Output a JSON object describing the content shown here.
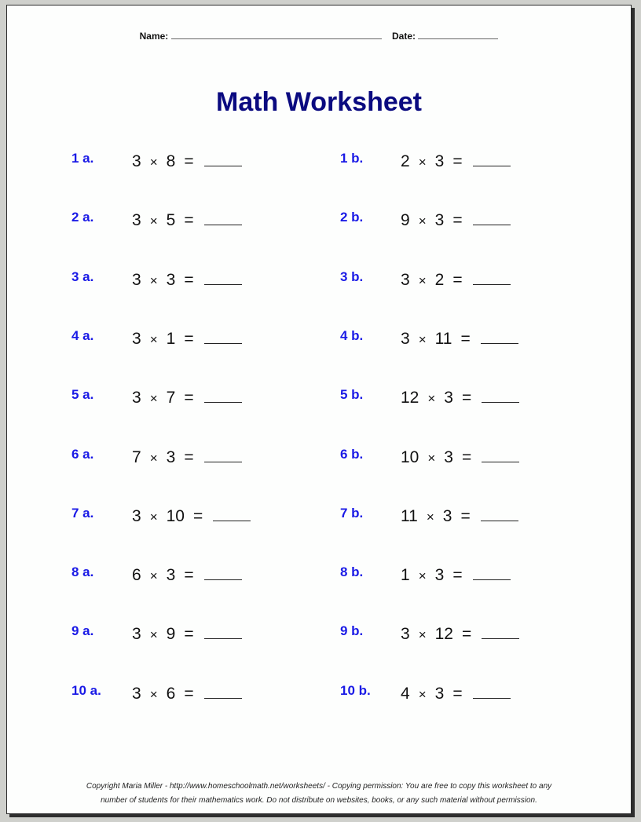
{
  "header": {
    "name_label": "Name:",
    "date_label": "Date:"
  },
  "title": "Math Worksheet",
  "problems": {
    "a": [
      {
        "label": "1 a.",
        "x": "3",
        "y": "8"
      },
      {
        "label": "2 a.",
        "x": "3",
        "y": "5"
      },
      {
        "label": "3 a.",
        "x": "3",
        "y": "3"
      },
      {
        "label": "4 a.",
        "x": "3",
        "y": "1"
      },
      {
        "label": "5 a.",
        "x": "3",
        "y": "7"
      },
      {
        "label": "6 a.",
        "x": "7",
        "y": "3"
      },
      {
        "label": "7 a.",
        "x": "3",
        "y": "10"
      },
      {
        "label": "8 a.",
        "x": "6",
        "y": "3"
      },
      {
        "label": "9 a.",
        "x": "3",
        "y": "9"
      },
      {
        "label": "10 a.",
        "x": "3",
        "y": "6"
      }
    ],
    "b": [
      {
        "label": "1 b.",
        "x": "2",
        "y": "3"
      },
      {
        "label": "2 b.",
        "x": "9",
        "y": "3"
      },
      {
        "label": "3 b.",
        "x": "3",
        "y": "2"
      },
      {
        "label": "4 b.",
        "x": "3",
        "y": "11"
      },
      {
        "label": "5 b.",
        "x": "12",
        "y": "3"
      },
      {
        "label": "6 b.",
        "x": "10",
        "y": "3"
      },
      {
        "label": "7 b.",
        "x": "11",
        "y": "3"
      },
      {
        "label": "8 b.",
        "x": "1",
        "y": "3"
      },
      {
        "label": "9 b.",
        "x": "3",
        "y": "12"
      },
      {
        "label": "10 b.",
        "x": "4",
        "y": "3"
      }
    ],
    "times_symbol": "×",
    "equals_symbol": "="
  },
  "footer": {
    "line1": "Copyright Maria Miller - http://www.homeschoolmath.net/worksheets/ - Copying permission: You are free to copy this worksheet to any",
    "line2": "number of students for their mathematics work. Do not distribute on websites, books, or any such material without permission."
  }
}
